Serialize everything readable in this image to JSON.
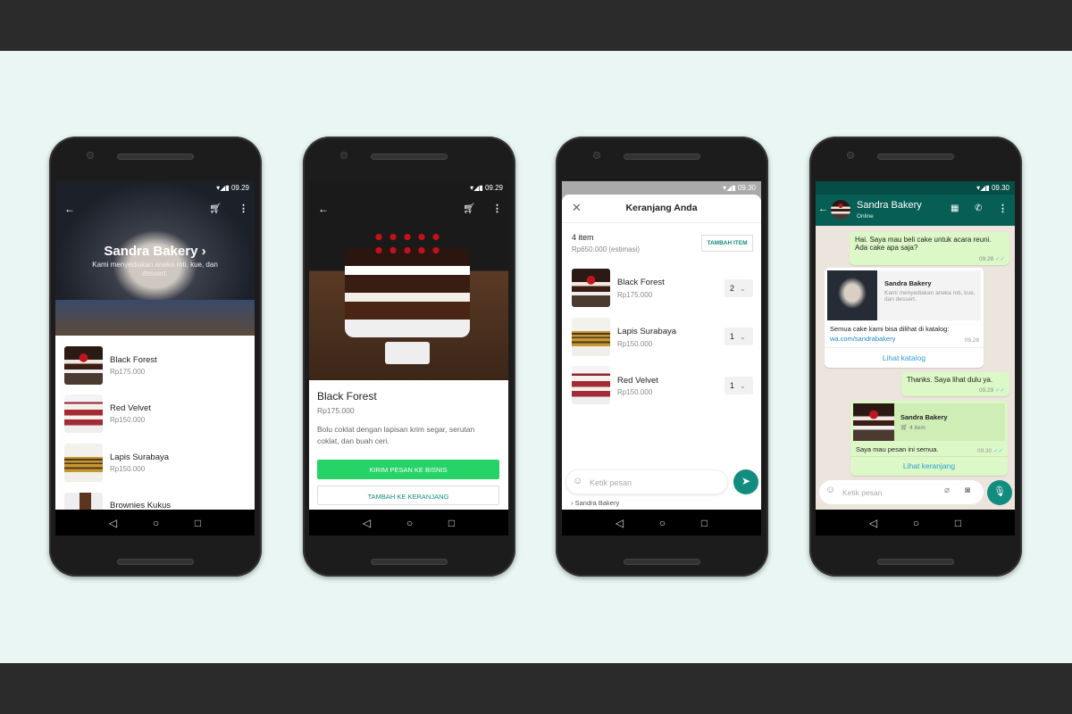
{
  "phone1": {
    "time": "09.29",
    "business_name": "Sandra Bakery",
    "description": "Kami menyediakan aneka roti, kue, dan dessert.",
    "items": [
      {
        "name": "Black Forest",
        "price": "Rp175.000"
      },
      {
        "name": "Red Velvet",
        "price": "Rp150.000"
      },
      {
        "name": "Lapis Surabaya",
        "price": "Rp150.000"
      },
      {
        "name": "Brownies Kukus",
        "price": ""
      }
    ]
  },
  "phone2": {
    "time": "09.29",
    "product_name": "Black Forest",
    "price": "Rp175.000",
    "description": "Bolu coklat dengan lapisan krim segar, serutan coklat, dan buah ceri.",
    "send_button": "KIRIM PESAN KE BISNIS",
    "add_to_cart_button": "TAMBAH KE KERANJANG",
    "accent": "#25d366"
  },
  "phone3": {
    "time": "09.30",
    "title": "Keranjang Anda",
    "count": "4 item",
    "total": "Rp650.000 (estimasi)",
    "add_item_button": "TAMBAH ITEM",
    "items": [
      {
        "name": "Black Forest",
        "price": "Rp175.000",
        "qty": "2"
      },
      {
        "name": "Lapis Surabaya",
        "price": "Rp150.000",
        "qty": "1"
      },
      {
        "name": "Red Velvet",
        "price": "Rp150.000",
        "qty": "1"
      }
    ],
    "input_placeholder": "Ketik pesan",
    "reply_to": "Sandra Bakery",
    "accent": "#128c7e"
  },
  "phone4": {
    "time": "09.30",
    "contact": "Sandra Bakery",
    "presence": "Online",
    "header_color": "#075e54",
    "messages": [
      {
        "text": "Hai. Saya mau beli cake untuk acara reuni. Ada cake apa saja?",
        "time": "09.28"
      },
      {
        "card_title": "Sandra Bakery",
        "card_desc": "Kami menyediakan aneka roti, kue, dan dessert.",
        "text": "Semua cake kami bisa dilihat di katalog:",
        "link": "wa.com/sandrabakery",
        "time": "09.28",
        "action": "Lihat katalog"
      },
      {
        "text": "Thanks. Saya lihat dulu ya.",
        "time": "09.29"
      },
      {
        "card_title": "Sandra Bakery",
        "card_desc": "4 item",
        "text": "Saya mau pesan ini semua.",
        "time": "09.30",
        "action": "Lihat keranjang"
      }
    ],
    "input_placeholder": "Ketik pesan"
  },
  "nav": {
    "back": "◁",
    "home": "○",
    "recents": "□"
  }
}
